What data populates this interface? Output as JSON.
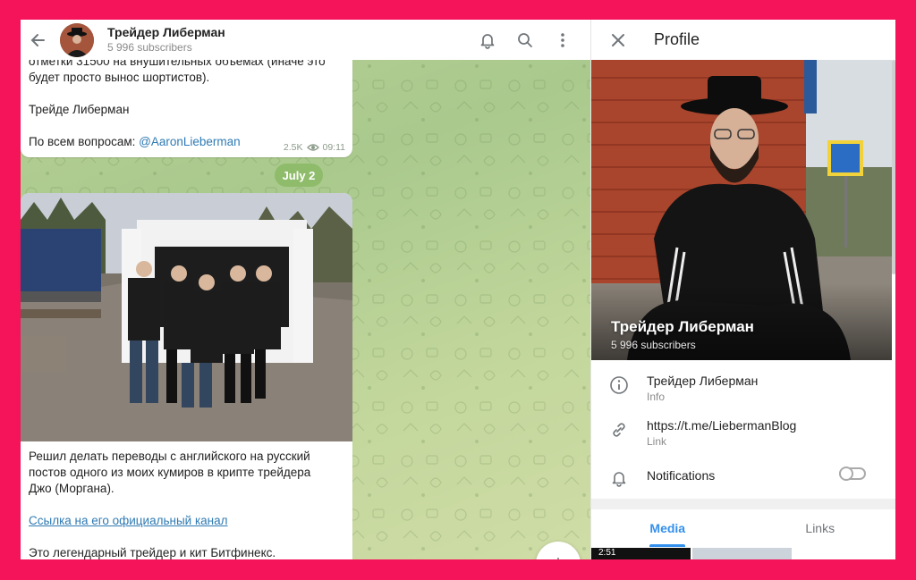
{
  "chat": {
    "title": "Трейдер Либерман",
    "subscribers": "5 996 subscribers",
    "icons": [
      "arrow-left-icon",
      "bell-icon",
      "search-icon",
      "more-vertical-icon"
    ],
    "message1": {
      "line1": "отметки 31500 на внушительных объемах (иначе это",
      "line2": "будет просто вынос шортистов).",
      "signature": "Трейде Либерман",
      "contact_prefix": "По всем вопросам: ",
      "contact_handle": "@AaronLieberman",
      "views": "2.5K",
      "time": "09:11"
    },
    "date_separator": "July 2",
    "message2": {
      "line1": "Решил делать переводы с английского на русский",
      "line2": "постов одного из моих кумиров в крипте трейдера",
      "line3": "Джо (Моргана).",
      "link_text": "Ссылка на его официальный канал",
      "line4": " Это легендарный трейдер и кит Битфинекс."
    }
  },
  "profile": {
    "header_title": "Profile",
    "name": "Трейдер Либерман",
    "subscribers": "5 996 subscribers",
    "info": {
      "value": "Трейдер Либерман",
      "label": "Info"
    },
    "link": {
      "value": "https://t.me/LiebermanBlog",
      "label": "Link"
    },
    "notifications": {
      "label": "Notifications",
      "enabled": false
    },
    "tabs": [
      "Media",
      "Links"
    ],
    "thumb_duration": "2:51"
  },
  "colors": {
    "frame": "#f5135a",
    "accent": "#3390ec",
    "date_pill": "#8fbc6b",
    "link": "#2f7ab3"
  }
}
